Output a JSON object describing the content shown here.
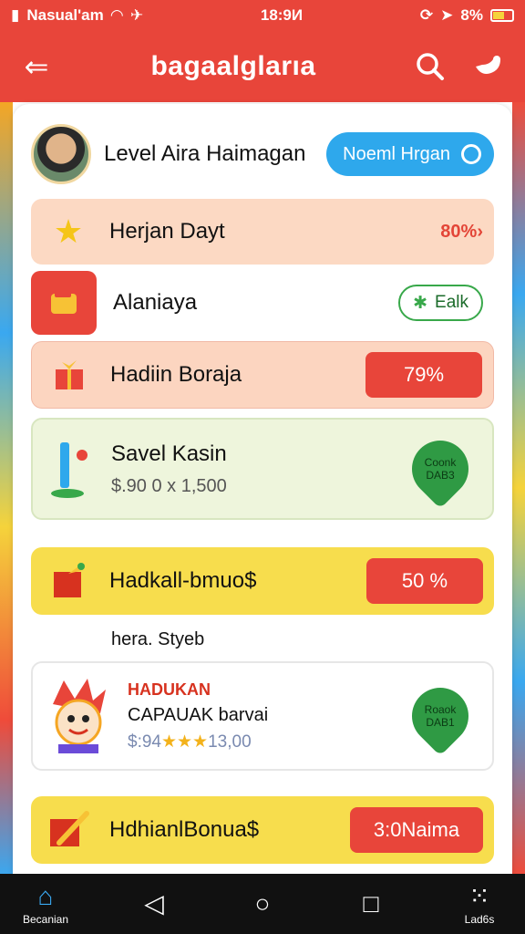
{
  "status_bar": {
    "carrier": "Nasual'am",
    "time": "18:9И",
    "battery": "8%"
  },
  "app_bar": {
    "title": "bagaalglarıa"
  },
  "profile": {
    "name": "Level Aira Haimagan",
    "action_label": "Noeml Hrgan"
  },
  "rows": [
    {
      "title": "Herjan Dayt",
      "value": "80%›"
    },
    {
      "title": "Alaniaya",
      "action_label": "Ealk"
    },
    {
      "title": "Hadiin Boraja",
      "action_label": "79%"
    },
    {
      "title": "Savel Kasin",
      "subtitle": "$.90 0  х 1,500",
      "badge": "Coonk\nDAB3"
    },
    {
      "title": "Hadkall-bmuo$",
      "action_label": "50 %"
    }
  ],
  "section_label": "hera. Styeb",
  "featured": {
    "tag": "HADUKAN",
    "title": "CAPAUAK barvai",
    "price_prefix": "$:94",
    "stars": "★★★",
    "price_suffix": "13,00",
    "badge": "Roaok\nDAB1"
  },
  "last_row": {
    "title": "HdhianlBonua$",
    "action_label": "3:0Naima"
  },
  "bottom_nav": {
    "home_label": "Becanian",
    "right_label": "Lad6s"
  },
  "colors": {
    "primary": "#e8453a",
    "blue": "#2ea8ec",
    "yellow": "#f7dd4d",
    "green": "#2f9a44"
  }
}
